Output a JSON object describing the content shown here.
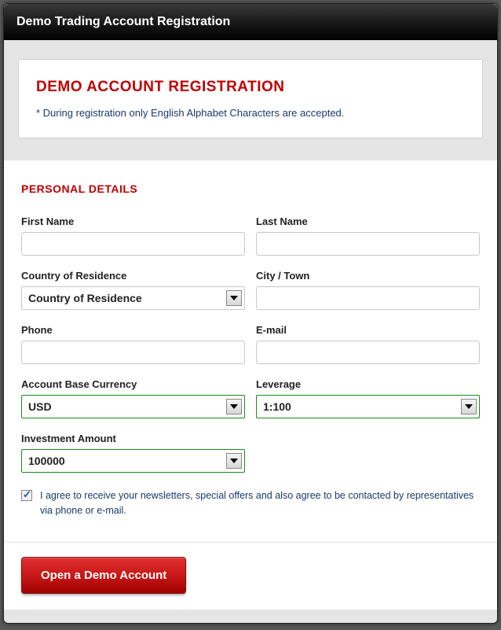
{
  "header": {
    "title": "Demo Trading Account Registration"
  },
  "intro": {
    "title": "DEMO ACCOUNT REGISTRATION",
    "note": "* During registration only English Alphabet Characters are accepted."
  },
  "section": {
    "personal_title": "PERSONAL DETAILS"
  },
  "fields": {
    "first_name": {
      "label": "First Name",
      "value": ""
    },
    "last_name": {
      "label": "Last Name",
      "value": ""
    },
    "country": {
      "label": "Country of Residence",
      "selected": "Country of Residence"
    },
    "city": {
      "label": "City / Town",
      "value": ""
    },
    "phone": {
      "label": "Phone",
      "value": ""
    },
    "email": {
      "label": "E-mail",
      "value": ""
    },
    "currency": {
      "label": "Account Base Currency",
      "selected": "USD"
    },
    "leverage": {
      "label": "Leverage",
      "selected": "1:100"
    },
    "investment": {
      "label": "Investment Amount",
      "selected": "100000"
    }
  },
  "consent": {
    "checked": true,
    "text": "I agree to receive your newsletters, special offers and also agree to be contacted by representatives via phone or e-mail."
  },
  "submit": {
    "label": "Open a Demo Account"
  }
}
